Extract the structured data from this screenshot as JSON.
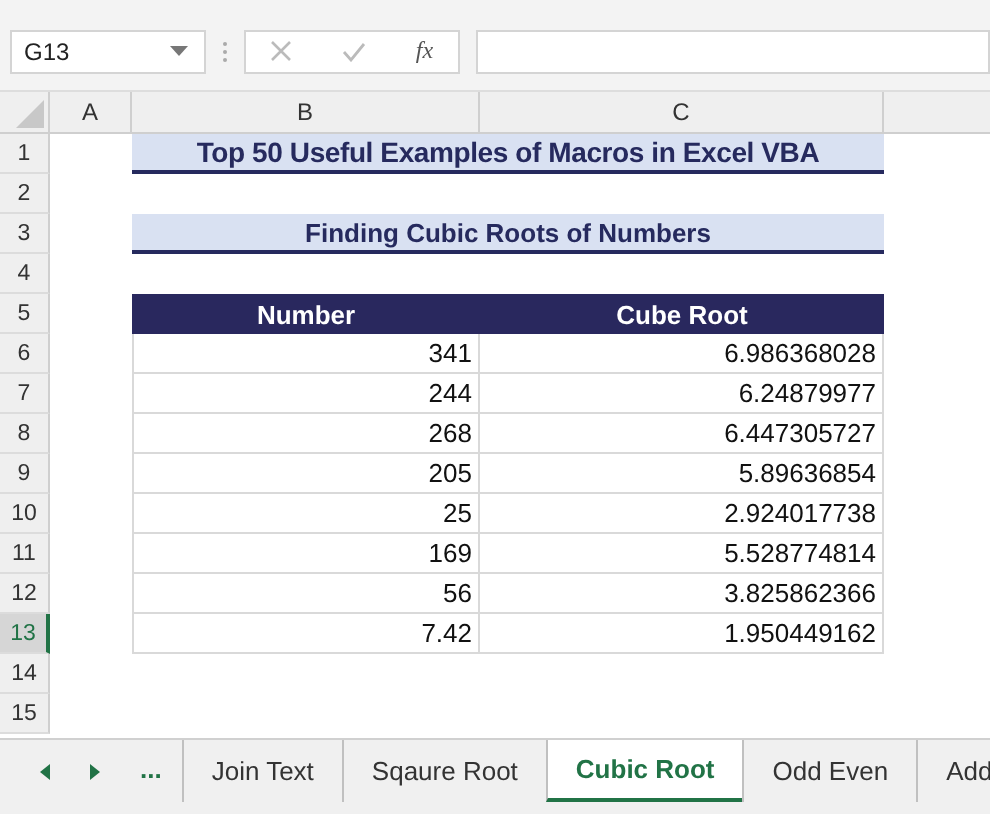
{
  "name_box": "G13",
  "formula_bar": {
    "function_label": "fx"
  },
  "columns": [
    {
      "label": "A"
    },
    {
      "label": "B"
    },
    {
      "label": "C"
    }
  ],
  "rows": [
    {
      "number": "1",
      "selected": false,
      "kind": "title",
      "text": "Top 50 Useful Examples of Macros in Excel VBA"
    },
    {
      "number": "2",
      "selected": false,
      "kind": "empty"
    },
    {
      "number": "3",
      "selected": false,
      "kind": "title",
      "text": "Finding Cubic Roots of Numbers"
    },
    {
      "number": "4",
      "selected": false,
      "kind": "empty"
    },
    {
      "number": "5",
      "selected": false,
      "kind": "header",
      "cells": [
        "Number",
        "Cube Root"
      ]
    },
    {
      "number": "6",
      "selected": false,
      "kind": "data",
      "cells": [
        "341",
        "6.986368028"
      ]
    },
    {
      "number": "7",
      "selected": false,
      "kind": "data",
      "cells": [
        "244",
        "6.24879977"
      ]
    },
    {
      "number": "8",
      "selected": false,
      "kind": "data",
      "cells": [
        "268",
        "6.447305727"
      ]
    },
    {
      "number": "9",
      "selected": false,
      "kind": "data",
      "cells": [
        "205",
        "5.89636854"
      ]
    },
    {
      "number": "10",
      "selected": false,
      "kind": "data",
      "cells": [
        "25",
        "2.924017738"
      ]
    },
    {
      "number": "11",
      "selected": false,
      "kind": "data",
      "cells": [
        "169",
        "5.528774814"
      ]
    },
    {
      "number": "12",
      "selected": false,
      "kind": "data",
      "cells": [
        "56",
        "3.825862366"
      ]
    },
    {
      "number": "13",
      "selected": true,
      "kind": "data",
      "cells": [
        "7.42",
        "1.950449162"
      ]
    },
    {
      "number": "14",
      "selected": false,
      "kind": "empty"
    },
    {
      "number": "15",
      "selected": false,
      "kind": "empty"
    }
  ],
  "sheet_tabs": {
    "more": "...",
    "tabs": [
      {
        "label": "Join Text",
        "selected": false
      },
      {
        "label": "Sqaure Root",
        "selected": false
      },
      {
        "label": "Cubic Root",
        "selected": true
      },
      {
        "label": "Odd Even",
        "selected": false
      },
      {
        "label": "Add",
        "selected": false
      }
    ]
  }
}
